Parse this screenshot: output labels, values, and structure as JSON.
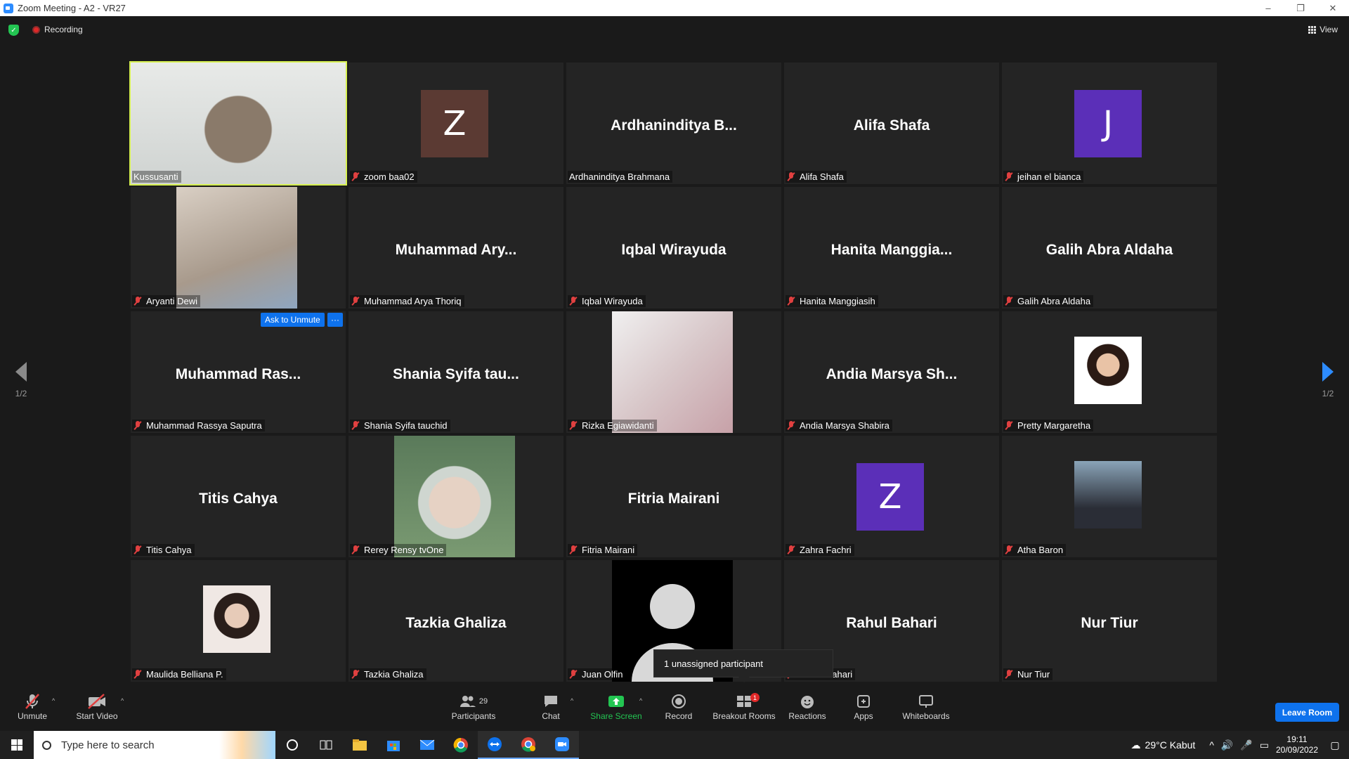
{
  "window": {
    "title": "Zoom Meeting - A2 - VR27",
    "minimize": "–",
    "restore": "❐",
    "close": "✕"
  },
  "topbar": {
    "recording": "Recording",
    "view": "View"
  },
  "navigation": {
    "left_page": "1/2",
    "right_page": "1/2"
  },
  "tiles": [
    {
      "label": "Kussusanti",
      "type": "photo",
      "active": true,
      "muted": false
    },
    {
      "label": "zoom baa02",
      "type": "avatar",
      "initial": "Z",
      "avatar_color": "#5b3a33",
      "muted": true
    },
    {
      "label": "Ardhaninditya Brahmana",
      "type": "name",
      "display": "Ardhaninditya  B...",
      "muted": false
    },
    {
      "label": "Alifa Shafa",
      "type": "name",
      "display": "Alifa Shafa",
      "muted": true
    },
    {
      "label": "jeihan el bianca",
      "type": "avatar",
      "initial": "J",
      "avatar_color": "#5b2fb8",
      "muted": true
    },
    {
      "label": "Aryanti Dewi",
      "type": "photo",
      "muted": true
    },
    {
      "label": "Muhammad Arya Thoriq",
      "type": "name",
      "display": "Muhammad  Ary...",
      "muted": true
    },
    {
      "label": "Iqbal Wirayuda",
      "type": "name",
      "display": "Iqbal Wirayuda",
      "muted": true
    },
    {
      "label": "Hanita Manggiasih",
      "type": "name",
      "display": "Hanita  Manggia...",
      "muted": true
    },
    {
      "label": "Galih Abra Aldaha",
      "type": "name",
      "display": "Galih Abra Aldaha",
      "muted": true
    },
    {
      "label": "Muhammad Rassya Saputra",
      "type": "name",
      "display": "Muhammad  Ras...",
      "muted": true,
      "ask_unmute": "Ask to Unmute",
      "more": "···"
    },
    {
      "label": "Shania Syifa tauchid",
      "type": "name",
      "display": "Shania  Syifa  tau...",
      "muted": true
    },
    {
      "label": "Rizka Egiawidanti",
      "type": "photo",
      "muted": true
    },
    {
      "label": "Andia Marsya Shabira",
      "type": "name",
      "display": "Andia  Marsya  Sh...",
      "muted": true
    },
    {
      "label": "Pretty Margaretha",
      "type": "photo-sm",
      "muted": true
    },
    {
      "label": "Titis Cahya",
      "type": "name",
      "display": "Titis Cahya",
      "muted": true
    },
    {
      "label": "Rerey Rensy tvOne",
      "type": "photo",
      "muted": true
    },
    {
      "label": "Fitria Mairani",
      "type": "name",
      "display": "Fitria Mairani",
      "muted": true
    },
    {
      "label": "Zahra Fachri",
      "type": "avatar",
      "initial": "Z",
      "avatar_color": "#5b2fb8",
      "muted": true
    },
    {
      "label": "Atha Baron",
      "type": "photo-sm",
      "muted": true
    },
    {
      "label": "Maulida Belliana P.",
      "type": "photo-sm",
      "muted": true
    },
    {
      "label": "Tazkia Ghaliza",
      "type": "name",
      "display": "Tazkia Ghaliza",
      "muted": true
    },
    {
      "label": "Juan Olfin",
      "type": "silhouette",
      "muted": true
    },
    {
      "label": "Rahul Bahari",
      "type": "name",
      "display": "Rahul Bahari",
      "muted": true
    },
    {
      "label": "Nur Tiur",
      "type": "name",
      "display": "Nur Tiur",
      "muted": true
    }
  ],
  "tooltip": {
    "text": "1 unassigned participant"
  },
  "toolbar": {
    "unmute": "Unmute",
    "start_video": "Start Video",
    "participants": "Participants",
    "participants_count": "29",
    "chat": "Chat",
    "share_screen": "Share Screen",
    "record": "Record",
    "breakout_rooms": "Breakout Rooms",
    "breakout_badge": "1",
    "reactions": "Reactions",
    "apps": "Apps",
    "whiteboards": "Whiteboards",
    "leave": "Leave Room",
    "caret": "^"
  },
  "taskbar": {
    "search_placeholder": "Type here to search",
    "weather": "29°C  Kabut",
    "time": "19:11",
    "date": "20/09/2022"
  },
  "colors": {
    "accent": "#0e72ed",
    "active_speaker": "#d6f050",
    "share_green": "#23c552",
    "muted_red": "#e04040"
  }
}
